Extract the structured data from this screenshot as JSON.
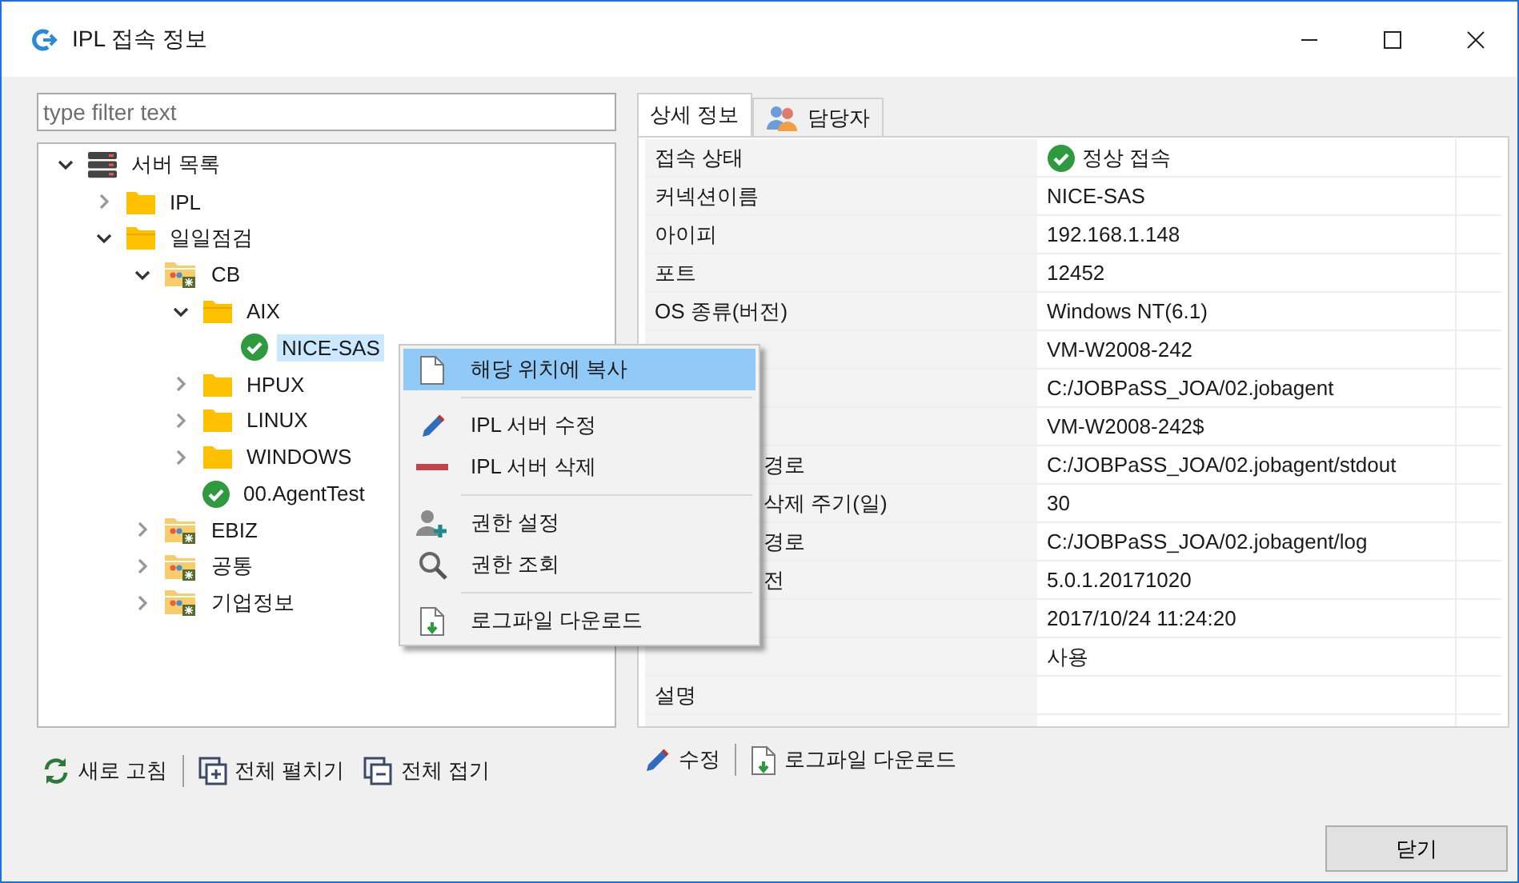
{
  "window": {
    "title": "IPL 접속 정보",
    "controls": [
      {
        "kind": "minimize"
      },
      {
        "kind": "maximize"
      },
      {
        "kind": "close"
      }
    ]
  },
  "filter": {
    "placeholder": "type filter text"
  },
  "tree": [
    {
      "label": "서버 목록",
      "kind": "servers",
      "expanded": true,
      "selected": false,
      "children": [
        {
          "label": "IPL",
          "kind": "folder",
          "expanded": false,
          "selected": false
        },
        {
          "label": "일일점검",
          "kind": "folder",
          "expanded": true,
          "selected": false,
          "children": [
            {
              "label": "CB",
              "kind": "group",
              "expanded": true,
              "selected": false,
              "children": [
                {
                  "label": "AIX",
                  "kind": "folder",
                  "expanded": true,
                  "selected": false,
                  "children": [
                    {
                      "label": "NICE-SAS",
                      "kind": "server",
                      "selected": true
                    }
                  ]
                },
                {
                  "label": "HPUX",
                  "kind": "folder",
                  "expanded": false,
                  "selected": false
                },
                {
                  "label": "LINUX",
                  "kind": "folder",
                  "expanded": false,
                  "selected": false
                },
                {
                  "label": "WINDOWS",
                  "kind": "folder",
                  "expanded": false,
                  "selected": false
                },
                {
                  "label": "00.AgentTest",
                  "kind": "server",
                  "selected": false
                }
              ]
            },
            {
              "label": "EBIZ",
              "kind": "group",
              "expanded": false,
              "selected": false
            },
            {
              "label": "공통",
              "kind": "group",
              "expanded": false,
              "selected": false
            },
            {
              "label": "기업정보",
              "kind": "group",
              "expanded": false,
              "selected": false
            }
          ]
        }
      ]
    }
  ],
  "left_toolbar": [
    {
      "label": "새로 고침",
      "kind": "refresh"
    },
    {
      "label": "전체 펼치기",
      "kind": "expand"
    },
    {
      "label": "전체 접기",
      "kind": "collapse"
    }
  ],
  "tabs": [
    {
      "label": "상세 정보",
      "kind": "plain",
      "selected": true
    },
    {
      "label": "담당자",
      "kind": "people",
      "selected": false
    }
  ],
  "details": [
    {
      "label": "접속 상태",
      "value": "정상 접속",
      "kind": "status"
    },
    {
      "label": "커넥션이름",
      "value": "NICE-SAS"
    },
    {
      "label": "아이피",
      "value": "192.168.1.148"
    },
    {
      "label": "포트",
      "value": "12452"
    },
    {
      "label": "OS 종류(버전)",
      "value": "Windows NT(6.1)"
    },
    {
      "value": "VM-W2008-242"
    },
    {
      "value": "C:/JOBPaSS_JOA/02.jobagent"
    },
    {
      "value": "VM-W2008-242$"
    },
    {
      "label": "경로",
      "label_covered": true,
      "value": "C:/JOBPaSS_JOA/02.jobagent/stdout"
    },
    {
      "label": "삭제 주기(일)",
      "label_covered": true,
      "value": "30"
    },
    {
      "label": "경로",
      "label_covered": true,
      "value": "C:/JOBPaSS_JOA/02.jobagent/log"
    },
    {
      "label": "전",
      "label_covered": true,
      "value": "5.0.1.20171020"
    },
    {
      "value": "2017/10/24 11:24:20"
    },
    {
      "value": "사용"
    },
    {
      "label": "설명"
    }
  ],
  "right_toolbar": [
    {
      "label": "수정",
      "kind": "edit"
    },
    {
      "label": "로그파일 다운로드",
      "kind": "download"
    }
  ],
  "context_menu": [
    {
      "label": "해당 위치에 복사",
      "kind": "copy",
      "selected": true
    },
    {
      "kind": "separator"
    },
    {
      "label": "IPL 서버 수정",
      "kind": "edit",
      "selected": false
    },
    {
      "label": "IPL 서버 삭제",
      "kind": "delete",
      "selected": false
    },
    {
      "kind": "separator"
    },
    {
      "label": "권한 설정",
      "kind": "add-user",
      "selected": false
    },
    {
      "label": "권한 조회",
      "kind": "search",
      "selected": false
    },
    {
      "kind": "separator"
    },
    {
      "label": "로그파일 다운로드",
      "kind": "download",
      "selected": false
    }
  ],
  "close_button": "닫기"
}
